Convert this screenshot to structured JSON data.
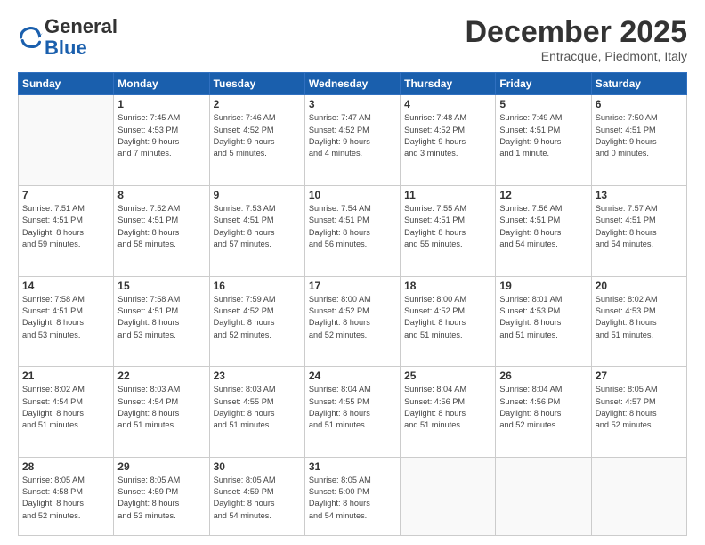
{
  "header": {
    "logo_line1": "General",
    "logo_line2": "Blue",
    "month": "December 2025",
    "location": "Entracque, Piedmont, Italy"
  },
  "weekdays": [
    "Sunday",
    "Monday",
    "Tuesday",
    "Wednesday",
    "Thursday",
    "Friday",
    "Saturday"
  ],
  "weeks": [
    [
      {
        "day": "",
        "info": ""
      },
      {
        "day": "1",
        "info": "Sunrise: 7:45 AM\nSunset: 4:53 PM\nDaylight: 9 hours\nand 7 minutes."
      },
      {
        "day": "2",
        "info": "Sunrise: 7:46 AM\nSunset: 4:52 PM\nDaylight: 9 hours\nand 5 minutes."
      },
      {
        "day": "3",
        "info": "Sunrise: 7:47 AM\nSunset: 4:52 PM\nDaylight: 9 hours\nand 4 minutes."
      },
      {
        "day": "4",
        "info": "Sunrise: 7:48 AM\nSunset: 4:52 PM\nDaylight: 9 hours\nand 3 minutes."
      },
      {
        "day": "5",
        "info": "Sunrise: 7:49 AM\nSunset: 4:51 PM\nDaylight: 9 hours\nand 1 minute."
      },
      {
        "day": "6",
        "info": "Sunrise: 7:50 AM\nSunset: 4:51 PM\nDaylight: 9 hours\nand 0 minutes."
      }
    ],
    [
      {
        "day": "7",
        "info": "Sunrise: 7:51 AM\nSunset: 4:51 PM\nDaylight: 8 hours\nand 59 minutes."
      },
      {
        "day": "8",
        "info": "Sunrise: 7:52 AM\nSunset: 4:51 PM\nDaylight: 8 hours\nand 58 minutes."
      },
      {
        "day": "9",
        "info": "Sunrise: 7:53 AM\nSunset: 4:51 PM\nDaylight: 8 hours\nand 57 minutes."
      },
      {
        "day": "10",
        "info": "Sunrise: 7:54 AM\nSunset: 4:51 PM\nDaylight: 8 hours\nand 56 minutes."
      },
      {
        "day": "11",
        "info": "Sunrise: 7:55 AM\nSunset: 4:51 PM\nDaylight: 8 hours\nand 55 minutes."
      },
      {
        "day": "12",
        "info": "Sunrise: 7:56 AM\nSunset: 4:51 PM\nDaylight: 8 hours\nand 54 minutes."
      },
      {
        "day": "13",
        "info": "Sunrise: 7:57 AM\nSunset: 4:51 PM\nDaylight: 8 hours\nand 54 minutes."
      }
    ],
    [
      {
        "day": "14",
        "info": "Sunrise: 7:58 AM\nSunset: 4:51 PM\nDaylight: 8 hours\nand 53 minutes."
      },
      {
        "day": "15",
        "info": "Sunrise: 7:58 AM\nSunset: 4:51 PM\nDaylight: 8 hours\nand 53 minutes."
      },
      {
        "day": "16",
        "info": "Sunrise: 7:59 AM\nSunset: 4:52 PM\nDaylight: 8 hours\nand 52 minutes."
      },
      {
        "day": "17",
        "info": "Sunrise: 8:00 AM\nSunset: 4:52 PM\nDaylight: 8 hours\nand 52 minutes."
      },
      {
        "day": "18",
        "info": "Sunrise: 8:00 AM\nSunset: 4:52 PM\nDaylight: 8 hours\nand 51 minutes."
      },
      {
        "day": "19",
        "info": "Sunrise: 8:01 AM\nSunset: 4:53 PM\nDaylight: 8 hours\nand 51 minutes."
      },
      {
        "day": "20",
        "info": "Sunrise: 8:02 AM\nSunset: 4:53 PM\nDaylight: 8 hours\nand 51 minutes."
      }
    ],
    [
      {
        "day": "21",
        "info": "Sunrise: 8:02 AM\nSunset: 4:54 PM\nDaylight: 8 hours\nand 51 minutes."
      },
      {
        "day": "22",
        "info": "Sunrise: 8:03 AM\nSunset: 4:54 PM\nDaylight: 8 hours\nand 51 minutes."
      },
      {
        "day": "23",
        "info": "Sunrise: 8:03 AM\nSunset: 4:55 PM\nDaylight: 8 hours\nand 51 minutes."
      },
      {
        "day": "24",
        "info": "Sunrise: 8:04 AM\nSunset: 4:55 PM\nDaylight: 8 hours\nand 51 minutes."
      },
      {
        "day": "25",
        "info": "Sunrise: 8:04 AM\nSunset: 4:56 PM\nDaylight: 8 hours\nand 51 minutes."
      },
      {
        "day": "26",
        "info": "Sunrise: 8:04 AM\nSunset: 4:56 PM\nDaylight: 8 hours\nand 52 minutes."
      },
      {
        "day": "27",
        "info": "Sunrise: 8:05 AM\nSunset: 4:57 PM\nDaylight: 8 hours\nand 52 minutes."
      }
    ],
    [
      {
        "day": "28",
        "info": "Sunrise: 8:05 AM\nSunset: 4:58 PM\nDaylight: 8 hours\nand 52 minutes."
      },
      {
        "day": "29",
        "info": "Sunrise: 8:05 AM\nSunset: 4:59 PM\nDaylight: 8 hours\nand 53 minutes."
      },
      {
        "day": "30",
        "info": "Sunrise: 8:05 AM\nSunset: 4:59 PM\nDaylight: 8 hours\nand 54 minutes."
      },
      {
        "day": "31",
        "info": "Sunrise: 8:05 AM\nSunset: 5:00 PM\nDaylight: 8 hours\nand 54 minutes."
      },
      {
        "day": "",
        "info": ""
      },
      {
        "day": "",
        "info": ""
      },
      {
        "day": "",
        "info": ""
      }
    ]
  ]
}
